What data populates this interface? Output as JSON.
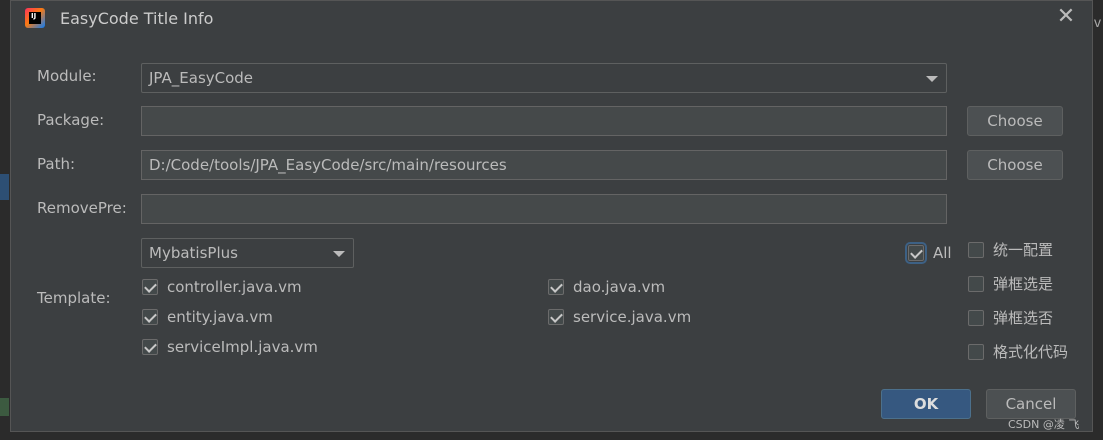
{
  "window": {
    "title": "EasyCode Title Info",
    "app_icon": "jetbrains-idea-icon"
  },
  "ide_background": {
    "right_fragment": "v"
  },
  "form": {
    "module": {
      "label": "Module:",
      "value": "JPA_EasyCode"
    },
    "package": {
      "label": "Package:",
      "value": "",
      "choose_label": "Choose"
    },
    "path": {
      "label": "Path:",
      "value": "D:/Code/tools/JPA_EasyCode/src/main/resources",
      "choose_label": "Choose"
    },
    "remove_pre": {
      "label": "RemovePre:",
      "value": ""
    }
  },
  "template": {
    "label": "Template:",
    "selected_group": "MybatisPlus",
    "all_label": "All",
    "all_checked": true,
    "items": [
      {
        "label": "controller.java.vm",
        "checked": true
      },
      {
        "label": "dao.java.vm",
        "checked": true
      },
      {
        "label": "entity.java.vm",
        "checked": true
      },
      {
        "label": "service.java.vm",
        "checked": true
      },
      {
        "label": "serviceImpl.java.vm",
        "checked": true
      }
    ]
  },
  "options": [
    {
      "label": "统一配置",
      "checked": false
    },
    {
      "label": "弹框选是",
      "checked": false
    },
    {
      "label": "弹框选否",
      "checked": false
    },
    {
      "label": "格式化代码",
      "checked": false
    }
  ],
  "buttons": {
    "ok": "OK",
    "cancel": "Cancel"
  },
  "watermark": "CSDN @凌 飞",
  "colors": {
    "dialog_bg": "#3c3f41",
    "field_bg": "#45494a",
    "ok_button": "#365880",
    "text": "#bbbbbb"
  }
}
